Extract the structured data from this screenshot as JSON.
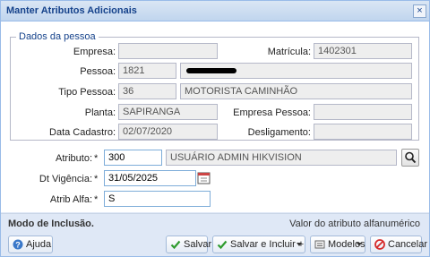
{
  "dialog": {
    "title": "Manter Atributos Adicionais"
  },
  "pessoa": {
    "legend": "Dados da pessoa",
    "empresa_label": "Empresa:",
    "empresa_value": "",
    "matricula_label": "Matrícula:",
    "matricula_value": "1402301",
    "pessoa_label": "Pessoa:",
    "pessoa_code": "1821",
    "tipo_label": "Tipo Pessoa:",
    "tipo_code": "36",
    "tipo_desc": "MOTORISTA CAMINHÃO",
    "planta_label": "Planta:",
    "planta_value": "SAPIRANGA",
    "empresa_pessoa_label": "Empresa Pessoa:",
    "empresa_pessoa_value": "",
    "data_cadastro_label": "Data Cadastro:",
    "data_cadastro_value": "02/07/2020",
    "desligamento_label": "Desligamento:",
    "desligamento_value": ""
  },
  "form": {
    "atributo_label": "Atributo:",
    "required_mark": "*",
    "atributo_code": "300",
    "atributo_desc": "USUÁRIO ADMIN HIKVISION",
    "vigencia_label": "Dt Vigência:",
    "vigencia_value": "31/05/2025",
    "alfa_label": "Atrib Alfa:",
    "alfa_value": "S"
  },
  "status": {
    "mode": "Modo de Inclusão.",
    "hint": "Valor do atributo alfanumérico"
  },
  "buttons": {
    "help": "Ajuda",
    "save": "Salvar",
    "save_include": "Salvar e Incluir +",
    "models": "Modelos",
    "cancel": "Cancelar"
  },
  "colors": {
    "accent": "#15428b",
    "panel": "#dfe8f6",
    "save_icon": "#2e9b2e",
    "cancel_icon": "#d62b2b"
  }
}
